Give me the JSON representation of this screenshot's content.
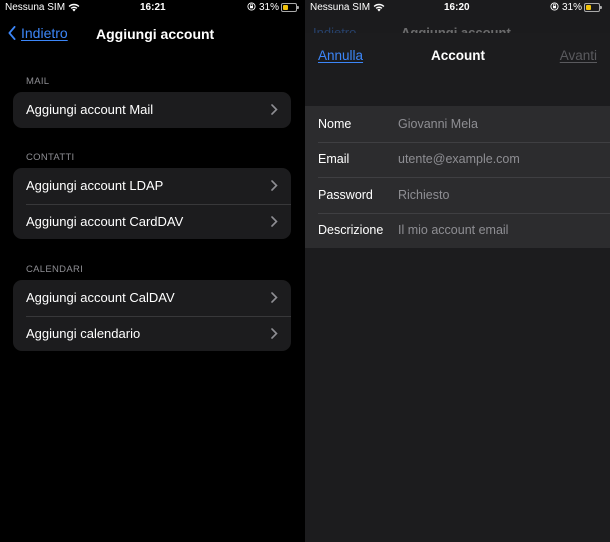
{
  "left": {
    "status": {
      "carrier": "Nessuna SIM",
      "time": "16:21",
      "battery": "31%"
    },
    "nav": {
      "back_label": "Indietro",
      "title": "Aggiungi account"
    },
    "sections": [
      {
        "header": "MAIL",
        "items": [
          "Aggiungi account Mail"
        ]
      },
      {
        "header": "CONTATTI",
        "items": [
          "Aggiungi account LDAP",
          "Aggiungi account CardDAV"
        ]
      },
      {
        "header": "CALENDARI",
        "items": [
          "Aggiungi account CalDAV",
          "Aggiungi calendario"
        ]
      }
    ]
  },
  "right": {
    "status": {
      "carrier": "Nessuna SIM",
      "time": "16:20",
      "battery": "31%"
    },
    "behind_nav": {
      "back_label": "Indietro",
      "title": "Aggiungi account"
    },
    "sheet": {
      "cancel_label": "Annulla",
      "title": "Account",
      "next_label": "Avanti"
    },
    "fields": [
      {
        "label": "Nome",
        "placeholder": "Giovanni Mela"
      },
      {
        "label": "Email",
        "placeholder": "utente@example.com"
      },
      {
        "label": "Password",
        "placeholder": "Richiesto"
      },
      {
        "label": "Descrizione",
        "placeholder": "Il mio account email"
      }
    ]
  },
  "colors": {
    "accent": "#3c86f8",
    "battery": "#f0c20b",
    "background": "#000000",
    "cell": "#1c1c1e"
  },
  "icons": [
    "wifi-icon",
    "rotation-lock-icon",
    "battery-icon",
    "chevron-left-icon",
    "chevron-right-icon"
  ]
}
